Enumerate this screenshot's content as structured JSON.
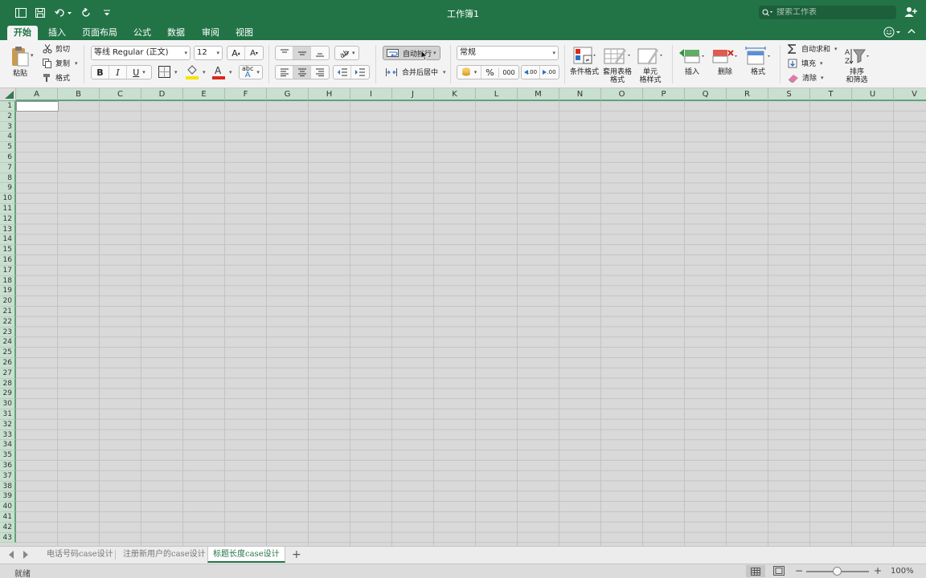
{
  "window": {
    "title": "工作簿1"
  },
  "search": {
    "placeholder": "搜索工作表"
  },
  "tabs": [
    {
      "label": "开始",
      "active": true
    },
    {
      "label": "插入"
    },
    {
      "label": "页面布局"
    },
    {
      "label": "公式"
    },
    {
      "label": "数据"
    },
    {
      "label": "审阅"
    },
    {
      "label": "视图"
    }
  ],
  "ribbon": {
    "clipboard": {
      "paste": "粘贴",
      "cut": "剪切",
      "copy": "复制",
      "format": "格式"
    },
    "font": {
      "name": "等线 Regular (正文)",
      "size": "12",
      "bold": "B",
      "italic": "I",
      "underline": "U",
      "phonetic": "abc"
    },
    "alignment": {
      "wrap_text": "自动换行",
      "merge_center": "合并后居中"
    },
    "number": {
      "format": "常规",
      "percent": "%",
      "thousands": "000",
      "inc_decimal": ".00",
      "dec_decimal": ".00"
    },
    "styles": {
      "conditional": "条件格式",
      "table_line1": "套用表格",
      "table_line2": "格式",
      "cell_line1": "单元",
      "cell_line2": "格样式"
    },
    "cells": {
      "insert": "插入",
      "delete": "删除",
      "format": "格式"
    },
    "editing": {
      "autosum": "自动求和",
      "fill": "填充",
      "clear": "清除",
      "sort_line1": "排序",
      "sort_line2": "和筛选"
    }
  },
  "grid": {
    "columns": [
      "A",
      "B",
      "C",
      "D",
      "E",
      "F",
      "G",
      "H",
      "I",
      "J",
      "K",
      "L",
      "M",
      "N",
      "O",
      "P",
      "Q",
      "R",
      "S",
      "T",
      "U",
      "V"
    ],
    "rows": [
      "1",
      "2",
      "3",
      "4",
      "5",
      "6",
      "7",
      "8",
      "9",
      "10",
      "11",
      "12",
      "13",
      "14",
      "15",
      "16",
      "17",
      "18",
      "19",
      "20",
      "21",
      "22",
      "23",
      "24",
      "25",
      "26",
      "27",
      "28",
      "29",
      "30",
      "31",
      "32",
      "33",
      "34",
      "35",
      "36",
      "37",
      "38",
      "39",
      "40",
      "41",
      "42",
      "43"
    ]
  },
  "sheets": [
    {
      "label": "电话号码case设计"
    },
    {
      "label": "注册新用户的case设计"
    },
    {
      "label": "标题长度case设计",
      "active": true
    }
  ],
  "add_sheet": "+",
  "status": {
    "text": "就绪",
    "zoom": "100%",
    "zoom_level": 1.0
  },
  "colors": {
    "brand": "#227447",
    "header_bg": "#c9dfcf"
  }
}
